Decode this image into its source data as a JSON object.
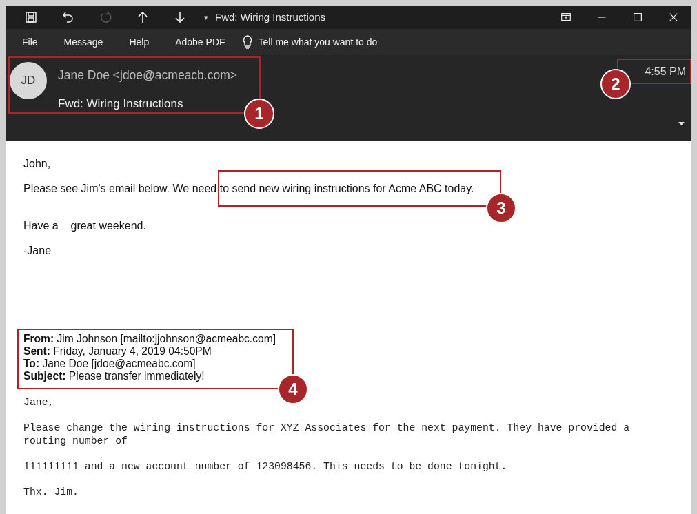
{
  "window": {
    "title": "Fwd: Wiring Instructions",
    "quick_access": [
      {
        "kind": "save",
        "disabled": false
      },
      {
        "kind": "undo",
        "disabled": false
      },
      {
        "kind": "redo",
        "disabled": true
      },
      {
        "kind": "up",
        "disabled": false
      },
      {
        "kind": "down",
        "disabled": false
      }
    ],
    "customize_glyph": "▾"
  },
  "menu": {
    "items": [
      "File",
      "Message",
      "Help",
      "Adobe PDF"
    ],
    "tell_me": "Tell me what you want to do"
  },
  "header": {
    "avatar_initials": "JD",
    "sender": "Jane Doe <jdoe@acmeacb.com>",
    "subject": "Fwd: Wiring Instructions",
    "time": "4:55 PM"
  },
  "body": {
    "paragraphs": [
      "John,",
      "Please see Jim's email below. We need to send new wiring instructions for Acme ABC today.",
      "Have a    great weekend.",
      "-Jane"
    ],
    "forwarded_header": [
      {
        "label": "From:",
        "value": "Jim Johnson [mailto:jjohnson@acmeabc.com]"
      },
      {
        "label": "Sent:",
        "value": "Friday, January 4, 2019 04:50PM"
      },
      {
        "label": "To:",
        "value": "Jane Doe [jdoe@acmeabc.com]"
      },
      {
        "label": "Subject:",
        "value": "Please transfer immediately!"
      }
    ],
    "forwarded_text": [
      "Jane,",
      "Please change the wiring instructions for XYZ Associates for the next payment. They have provided a routing number of",
      "111111111 and a new account number of 123098456. This needs to be done tonight.",
      "Thx. Jim."
    ]
  },
  "annotations": [
    "1",
    "2",
    "3",
    "4"
  ]
}
